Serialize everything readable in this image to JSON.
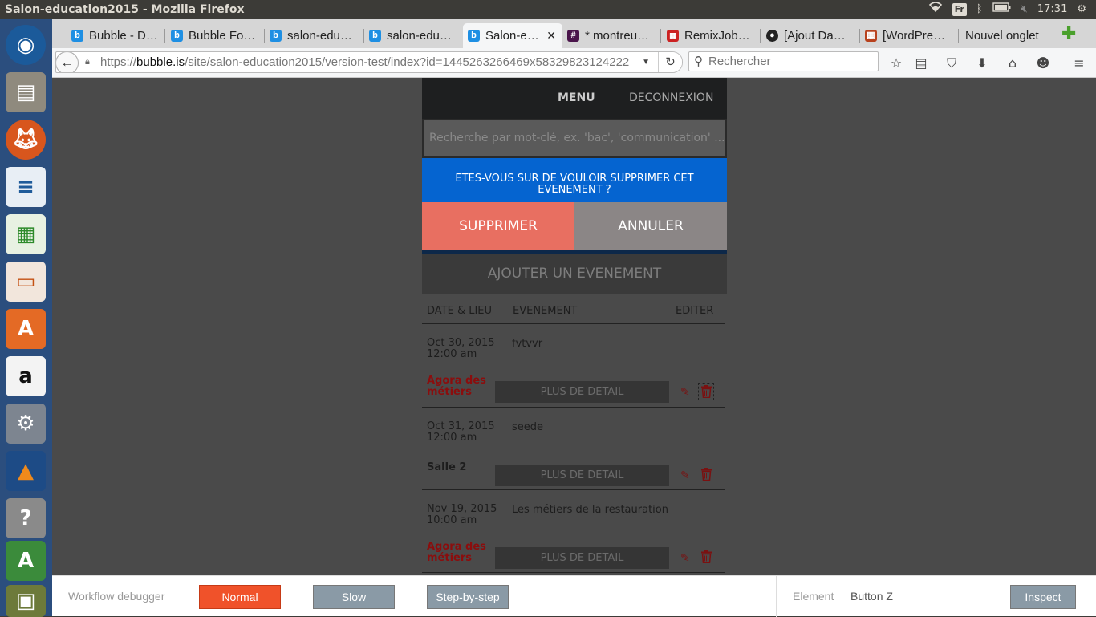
{
  "os": {
    "window_title": "Salon-education2015 - Mozilla Firefox",
    "keyboard_layout": "Fr",
    "clock": "17:31"
  },
  "launcher": {
    "items": [
      "ubuntu-icon",
      "files-icon",
      "firefox-icon",
      "writer-icon",
      "calc-icon",
      "impress-icon",
      "software-center-icon",
      "amazon-icon",
      "system-settings-icon",
      "vlc-icon",
      "help-icon",
      "updater-icon",
      "trash-icon"
    ]
  },
  "browser": {
    "tabs": [
      {
        "label": "Bubble - D…",
        "icon": "bubble"
      },
      {
        "label": "Bubble Fo…",
        "icon": "bubble"
      },
      {
        "label": "salon-edu…",
        "icon": "bubble"
      },
      {
        "label": "salon-edu…",
        "icon": "bubble"
      },
      {
        "label": "Salon-e…",
        "icon": "bubble",
        "active": true
      },
      {
        "label": "* montreu…",
        "icon": "slack"
      },
      {
        "label": "RemixJob…",
        "icon": "remix"
      },
      {
        "label": "[Ajout Da…",
        "icon": "github"
      },
      {
        "label": "[WordPre…",
        "icon": "wordpress"
      },
      {
        "label": "Nouvel onglet",
        "icon": "none"
      }
    ],
    "url_prefix": "https://",
    "url_domain": "bubble.is",
    "url_path": "/site/salon-education2015/version-test/index?id=1445263266469x58329823124222",
    "search_placeholder": "Rechercher"
  },
  "app": {
    "menu_label": "MENU",
    "logout_label": "DECONNEXION",
    "search_placeholder": "Recherche par mot-clé, ex. 'bac', 'communication' ...",
    "confirm_text": "ETES-VOUS SUR DE VOULOIR SUPPRIMER CET EVENEMENT ?",
    "delete_label": "SUPPRIMER",
    "cancel_label": "ANNULER",
    "add_event_label": "AJOUTER UN EVENEMENT",
    "columns": [
      "DATE & LIEU",
      "EVENEMENT",
      "EDITER"
    ],
    "details_label": "PLUS DE DETAIL",
    "events": [
      {
        "date": "Oct 30, 2015",
        "time": "12:00 am",
        "name": "fvtvvr",
        "place": "Agora des métiers",
        "place_color": "#8b0d0d"
      },
      {
        "date": "Oct 31, 2015",
        "time": "12:00 am",
        "name": "seede",
        "place": "Salle 2",
        "place_color": "#1d1d1d"
      },
      {
        "date": "Nov 19, 2015",
        "time": "10:00 am",
        "name": "Les métiers de la restauration",
        "place": "Agora des métiers",
        "place_color": "#8b0d0d"
      }
    ]
  },
  "debugger": {
    "label": "Workflow debugger",
    "normal_label": "Normal",
    "slow_label": "Slow",
    "step_label": "Step-by-step",
    "element_label": "Element",
    "element_value": "Button Z",
    "inspect_label": "Inspect"
  },
  "colors": {
    "confirm_blue": "#0564d0",
    "delete_red": "#e86f61",
    "cancel_gray": "#8b8686",
    "normal_orange": "#f0522a",
    "debug_gray": "#8a9aa6"
  }
}
